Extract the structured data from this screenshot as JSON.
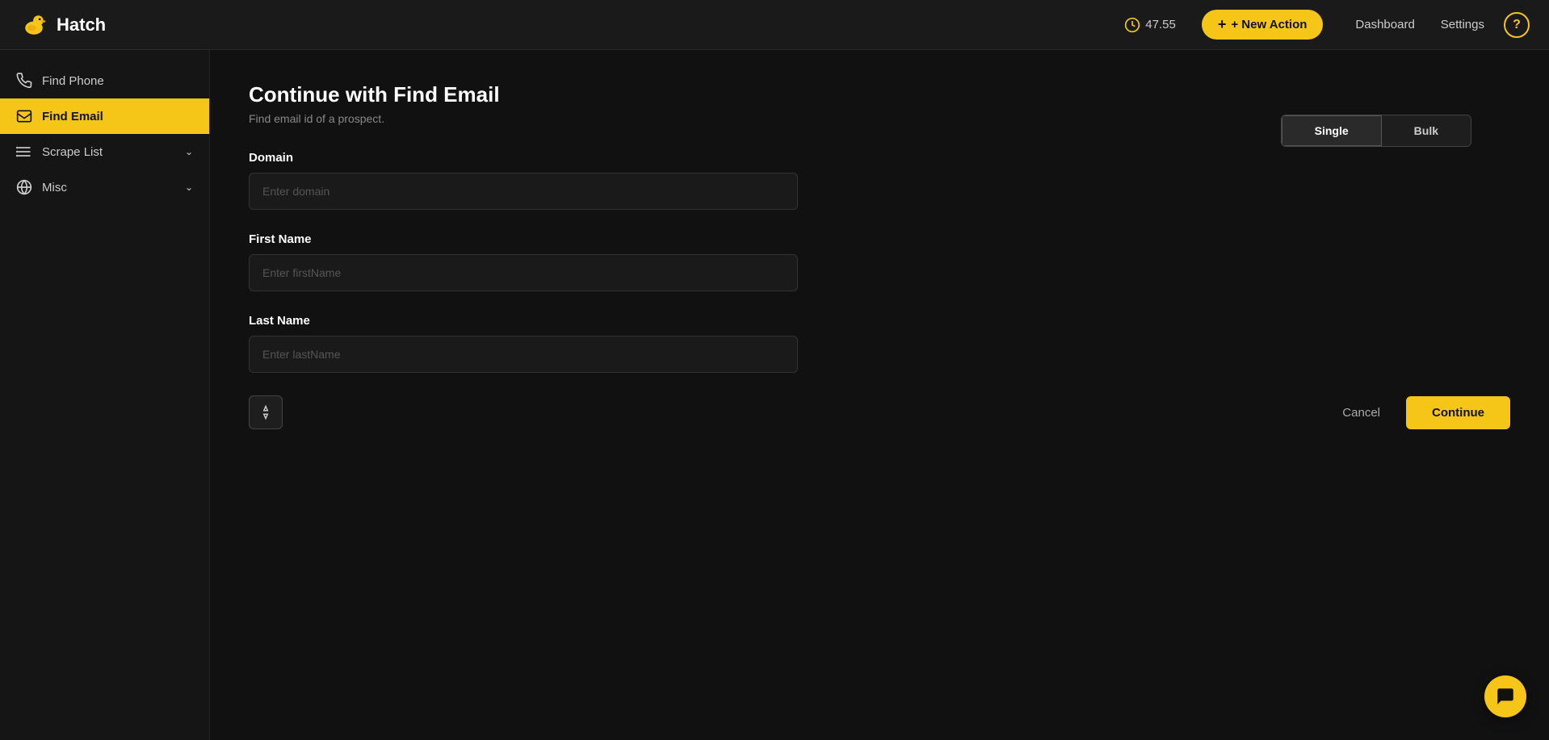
{
  "app": {
    "title": "Hatch"
  },
  "header": {
    "credits": "47.55",
    "new_action_label": "+ New Action",
    "nav": {
      "dashboard": "Dashboard",
      "settings": "Settings"
    },
    "help_label": "?"
  },
  "sidebar": {
    "items": [
      {
        "id": "find-phone",
        "label": "Find Phone",
        "icon": "phone-icon",
        "active": false
      },
      {
        "id": "find-email",
        "label": "Find Email",
        "icon": "email-icon",
        "active": true
      },
      {
        "id": "scrape-list",
        "label": "Scrape List",
        "icon": "list-icon",
        "active": false,
        "has_chevron": true
      },
      {
        "id": "misc",
        "label": "Misc",
        "icon": "globe-icon",
        "active": false,
        "has_chevron": true
      }
    ]
  },
  "main": {
    "title": "Continue with Find Email",
    "subtitle": "Find email id of a prospect.",
    "mode_toggle": {
      "single_label": "Single",
      "bulk_label": "Bulk",
      "active": "single"
    },
    "form": {
      "domain_label": "Domain",
      "domain_placeholder": "Enter domain",
      "first_name_label": "First Name",
      "first_name_placeholder": "Enter firstName",
      "last_name_label": "Last Name",
      "last_name_placeholder": "Enter lastName"
    },
    "actions": {
      "cancel_label": "Cancel",
      "continue_label": "Continue"
    }
  }
}
